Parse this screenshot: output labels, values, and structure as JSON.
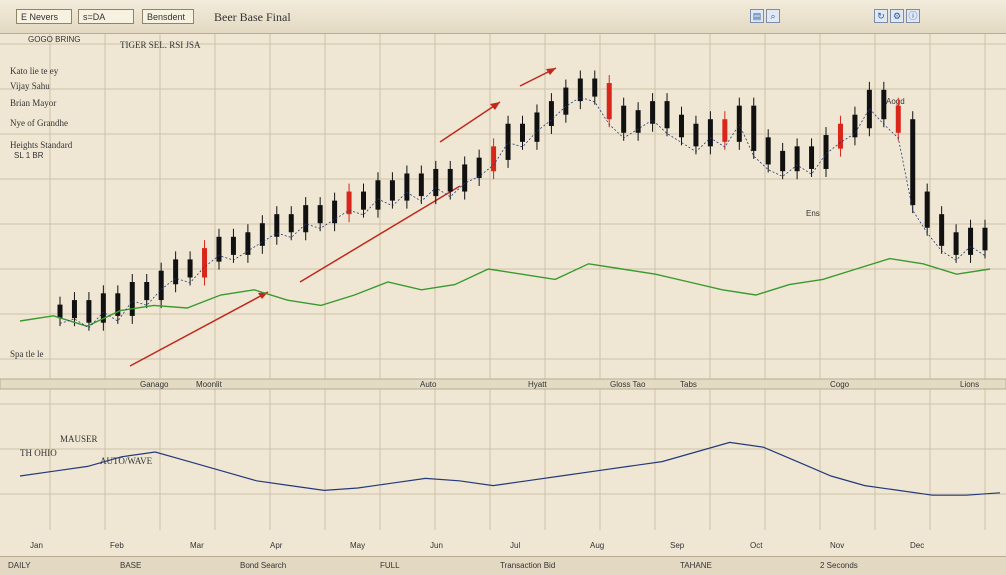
{
  "window": {
    "title": "Beer Base Final",
    "toolbar_items": [
      "E Nevers",
      "s=DA",
      "Bensdent"
    ],
    "tool_icons": [
      "chart-icon",
      "zoom-icon",
      "refresh-icon",
      "settings-icon",
      "info-icon"
    ]
  },
  "legend": {
    "header": "GOGO BRING",
    "lines": [
      "Kato lie te ey",
      "Vijay Sahu",
      "Brian Mayor",
      "Nye of Grandhe",
      "Heights Standard"
    ],
    "top_caption": "TIGER SEL. RSI JSA",
    "side_note": "SL 1 BR"
  },
  "lower_panel": {
    "caption_a": "MAUSER",
    "caption_b": "TH OHIO",
    "caption_c": "AUTO/WAVE",
    "left_note": "Spa tle le"
  },
  "price_labels": {
    "peak": "Aogd",
    "trough": "Ens"
  },
  "separator_labels": [
    "Ganago",
    "Moonlit",
    "Auto",
    "Hyatt",
    "Gloss Tao",
    "Tabs",
    "Cogo",
    "Lions"
  ],
  "bottom_axis_labels": [
    "Jan",
    "Feb",
    "Mar",
    "Apr",
    "May",
    "Jun",
    "Jul",
    "Aug",
    "Sep",
    "Oct",
    "Nov",
    "Dec"
  ],
  "statusbar": {
    "items": [
      "DAILY",
      "BASE",
      "Bond Search",
      "FULL",
      "Transaction Bid",
      "TAHANE",
      "2 Seconds"
    ]
  },
  "colors": {
    "background": "#efe7d4",
    "grid": "#cfc2a8",
    "candle": "#111111",
    "candle_red": "#d8261b",
    "trend_arrow": "#c0281c",
    "green_line": "#3a9a2e",
    "navy_line": "#233a7a"
  },
  "chart_data": {
    "type": "candlestick",
    "note": "approximate price series read from the chart",
    "series": [
      {
        "name": "Price",
        "values": [
          30,
          32,
          28,
          35,
          31,
          40,
          38,
          45,
          50,
          48,
          55,
          60,
          58,
          62,
          66,
          70,
          68,
          74,
          72,
          76,
          80,
          78,
          85,
          82,
          88,
          84,
          90,
          86,
          92,
          95,
          100,
          110,
          108,
          115,
          120,
          126,
          130,
          128,
          118,
          112,
          116,
          120,
          114,
          110,
          106,
          112,
          108,
          118,
          104,
          98,
          95,
          100,
          96,
          105,
          110,
          114,
          125,
          118,
          112,
          80,
          70,
          62,
          58,
          64,
          60
        ]
      },
      {
        "name": "Indicator",
        "values": [
          40,
          42,
          38,
          44,
          46,
          45,
          50,
          52,
          48,
          46,
          50,
          55,
          52,
          54,
          60,
          58,
          56,
          62,
          60,
          58,
          55,
          52,
          50,
          54,
          56,
          60,
          64,
          62,
          58,
          60
        ]
      },
      {
        "name": "Oscillator",
        "values": [
          20,
          22,
          24,
          28,
          30,
          26,
          22,
          18,
          16,
          14,
          15,
          17,
          19,
          18,
          16,
          18,
          20,
          22,
          24,
          26,
          30,
          34,
          32,
          26,
          20,
          16,
          14,
          12,
          12,
          13
        ]
      }
    ]
  }
}
